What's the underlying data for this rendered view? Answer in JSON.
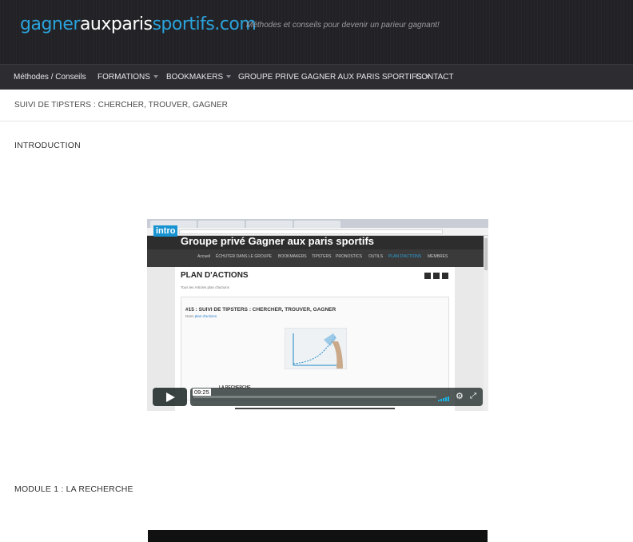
{
  "header": {
    "logo_part1": "gagner",
    "logo_part2": "aux",
    "logo_part3": "paris",
    "logo_part4": "sportifs.com",
    "tagline": "Méthodes et conseils pour devenir un parieur gagnant!"
  },
  "nav": {
    "items": [
      {
        "label": "Méthodes / Conseils",
        "has_dropdown": false
      },
      {
        "label": "FORMATIONS",
        "has_dropdown": true
      },
      {
        "label": "BOOKMAKERS",
        "has_dropdown": true
      },
      {
        "label": "GROUPE PRIVE GAGNER AUX PARIS SPORTIFS",
        "has_dropdown": true
      },
      {
        "label": "CONTACT",
        "has_dropdown": false
      }
    ]
  },
  "page": {
    "title": "SUIVI DE TIPSTERS : CHERCHER, TROUVER, GAGNER",
    "section1": "INTRODUCTION",
    "section2": "MODULE 1 : LA RECHERCHE"
  },
  "video": {
    "badge": "intro",
    "site_title": "Groupe privé Gagner aux paris sportifs",
    "site_nav": [
      "Accueil",
      "ÉCHUTER DANS LE GROUPE",
      "BOOKMAKERS",
      "TIPSTERS",
      "PRONOSTICS",
      "OUTILS",
      "PLAN D'ACTIONS",
      "MEMBRES"
    ],
    "heading": "PLAN D'ACTIONS",
    "crumb": "Tous les Articles    plan d'actions",
    "article_title": "#15 : SUIVI DE TIPSTERS : CHERCHER, TROUVER, GAGNER",
    "article_sub_prefix": "Dans",
    "article_sub_link": "plan d'actions",
    "article_foot": "LA RECHERCHE",
    "timestamp": "09:25"
  }
}
